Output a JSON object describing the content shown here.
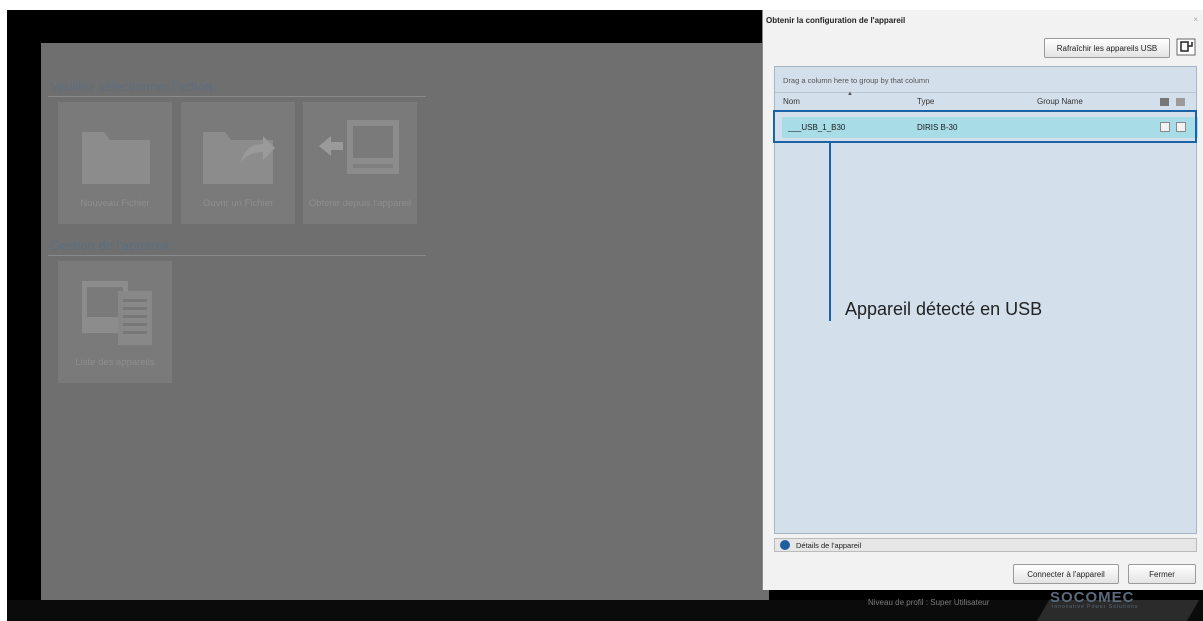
{
  "app": {
    "section_action": "Veuillez sélectionner l'action :",
    "section_device": "Gestion de l'appareil :",
    "tiles": [
      {
        "label": "Nouveau Fichier",
        "icon": "folder-icon"
      },
      {
        "label": "Ouvrir un Fichier",
        "icon": "folder-open-arrow-icon"
      },
      {
        "label": "Obtenir depuis l'appareil",
        "icon": "device-download-icon"
      },
      {
        "label": "Liste des appareils",
        "icon": "device-list-icon"
      }
    ],
    "profile_level": "Niveau de profil : Super Utilisateur",
    "logo_text": "SOCOMEC",
    "logo_sub": "Innovative Power Solutions"
  },
  "dialog": {
    "title": "Obtenir la configuration de l'appareil",
    "refresh_label": "Rafraîchir les appareils USB",
    "group_hint": "Drag a column here to group by that column",
    "columns": [
      "Nom",
      "Type",
      "Group Name"
    ],
    "rows": [
      {
        "nom": "___USB_1_B30",
        "type": "DIRIS B-30",
        "group": ""
      }
    ],
    "details_label": "Détails de l'appareil",
    "connect_label": "Connecter à l'appareil",
    "close_label": "Fermer"
  },
  "annotation": {
    "text": "Appareil détecté en USB",
    "color": "#1b62a6"
  }
}
